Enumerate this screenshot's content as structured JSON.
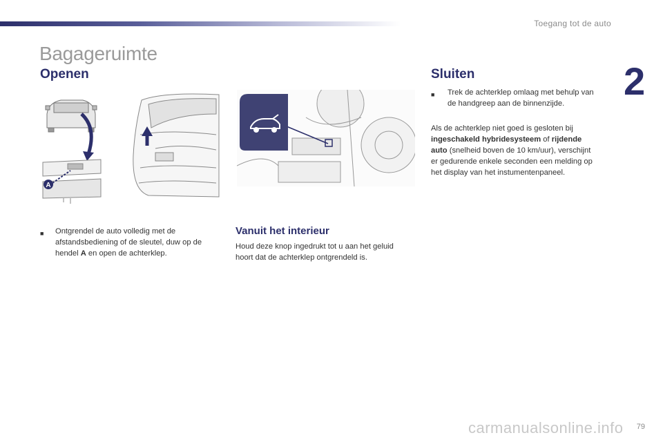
{
  "header": {
    "section": "Toegang tot de auto",
    "chapter": "2"
  },
  "title": "Bagageruimte",
  "openen": {
    "heading": "Openen",
    "bullet_icon": "check-box-icon",
    "text_1": "Ontgrendel de auto volledig met de",
    "text_2": "afstandsbediening of de sleutel, duw op de",
    "text_3_pre": "hendel ",
    "text_3_bold": "A",
    "text_3_post": " en open de achterklep.",
    "figure_label": "A"
  },
  "vanuit": {
    "heading": "Vanuit het interieur",
    "text_1": "Houd deze knop ingedrukt tot u aan het geluid",
    "text_2": "hoort dat de achterklep ontgrendeld is."
  },
  "sluiten": {
    "heading": "Sluiten",
    "bullet_1": "Trek de achterklep omlaag met behulp van",
    "bullet_2": "de handgreep aan de binnenzijde.",
    "p1": "Als de achterklep niet goed is gesloten bij",
    "p2_bold": "ingeschakeld hybridesysteem",
    "p2_mid": " of ",
    "p2_bold2": "rijdende",
    "p3_bold": "auto",
    "p3_rest": " (snelheid boven de 10 km/uur), verschijnt",
    "p4": "er gedurende enkele seconden een melding op",
    "p5": "het display van het instumentenpaneel."
  },
  "footer": {
    "page": "79",
    "watermark": "carmanualsonline.info"
  },
  "colors": {
    "brand": "#2c2f6b",
    "title_grey": "#9a9a9a"
  }
}
